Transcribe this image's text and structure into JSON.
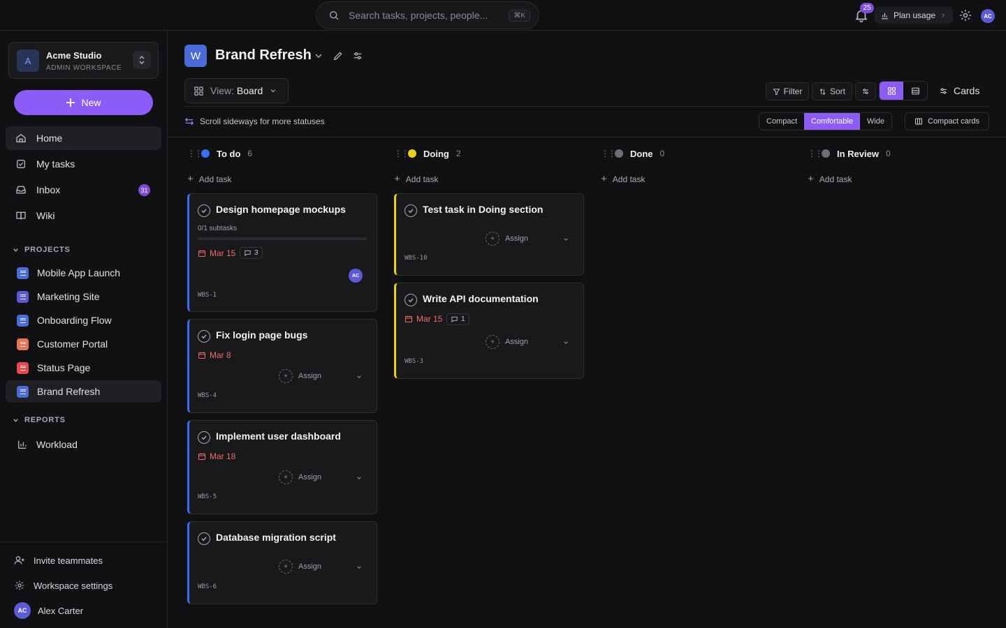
{
  "topbar": {
    "search_placeholder": "Search tasks, projects, people...",
    "shortcut": "⌘K",
    "notifications_count": "25",
    "plan_usage": "Plan usage",
    "user_initials": "AC"
  },
  "sidebar": {
    "workspace_logo": "A",
    "workspace_name": "Acme Studio",
    "workspace_sub": "ADMIN WORKSPACE",
    "new_label": "New",
    "nav": [
      {
        "label": "Home",
        "icon": "home-icon"
      },
      {
        "label": "My tasks",
        "icon": "check-icon"
      },
      {
        "label": "Inbox",
        "icon": "inbox-icon",
        "badge": "31"
      },
      {
        "label": "Wiki",
        "icon": "book-icon"
      }
    ],
    "projects_heading": "PROJECTS",
    "projects": [
      {
        "label": "Mobile App Launch",
        "color": "#4a6cd8"
      },
      {
        "label": "Marketing Site",
        "color": "#5b5bd6"
      },
      {
        "label": "Onboarding Flow",
        "color": "#4a6cd8"
      },
      {
        "label": "Customer Portal",
        "color": "#e8735a"
      },
      {
        "label": "Status Page",
        "color": "#e5484d"
      },
      {
        "label": "Brand Refresh",
        "color": "#4a6cd8"
      }
    ],
    "reports_heading": "REPORTS",
    "reports": [
      {
        "label": "Workload"
      }
    ],
    "invite": "Invite teammates",
    "settings": "Workspace settings",
    "user_initials": "AC",
    "user_name": "Alex Carter"
  },
  "header": {
    "project_logo": "W",
    "title": "Brand Refresh",
    "view_prefix": "View:",
    "view_value": "Board",
    "filter": "Filter",
    "sort": "Sort",
    "cards": "Cards",
    "hint": "Scroll sideways for more statuses",
    "density": [
      "Compact",
      "Comfortable",
      "Wide"
    ],
    "density_selected": "Comfortable",
    "compact_cards": "Compact cards"
  },
  "accent": "#8b5cf6",
  "columns": [
    {
      "name": "To do",
      "count": "6",
      "color": "#3b6cf6",
      "add": "Add task"
    },
    {
      "name": "Doing",
      "count": "2",
      "color": "#e6d21a",
      "add": "Add task"
    },
    {
      "name": "Done",
      "count": "0",
      "color": "#6e6e76",
      "add": "Add task"
    },
    {
      "name": "In Review",
      "count": "0",
      "color": "#6e6e76",
      "add": "Add task"
    }
  ],
  "cards": {
    "c1": {
      "title": "Design homepage mockups",
      "subtasks": "0/1 subtasks",
      "subtask_progress": 0,
      "due": "Mar 15",
      "comments": "3",
      "assignee": "AC",
      "id": "WBS-1"
    },
    "c2": {
      "title": "Fix login page bugs",
      "due": "Mar 8",
      "assign": "Assign",
      "id": "WBS-4"
    },
    "c3": {
      "title": "Implement user dashboard",
      "due": "Mar 18",
      "assign": "Assign",
      "id": "WBS-5"
    },
    "c4": {
      "title": "Database migration script",
      "assign": "Assign",
      "id": "WBS-6"
    },
    "d1": {
      "title": "Test task in Doing section",
      "assign": "Assign",
      "id": "WBS-10"
    },
    "d2": {
      "title": "Write API documentation",
      "due": "Mar 15",
      "comments": "1",
      "assign": "Assign",
      "id": "WBS-3"
    }
  }
}
